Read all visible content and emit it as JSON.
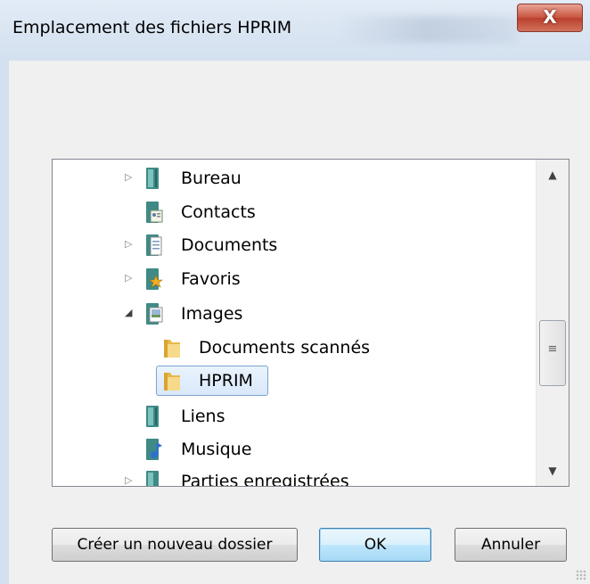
{
  "window": {
    "title": "Emplacement des fichiers HPRIM",
    "close_label": "X"
  },
  "tree": {
    "items": [
      {
        "label": "Bureau",
        "icon": "desktop-folder-icon",
        "expander": "collapsed"
      },
      {
        "label": "Contacts",
        "icon": "contacts-icon",
        "expander": "none"
      },
      {
        "label": "Documents",
        "icon": "documents-library-icon",
        "expander": "collapsed"
      },
      {
        "label": "Favoris",
        "icon": "favorites-icon",
        "expander": "collapsed"
      },
      {
        "label": "Images",
        "icon": "pictures-library-icon",
        "expander": "expanded"
      },
      {
        "label": "Documents scannés",
        "icon": "folder-icon",
        "expander": "none"
      },
      {
        "label": "HPRIM",
        "icon": "folder-icon",
        "expander": "none",
        "selected": true
      },
      {
        "label": "Liens",
        "icon": "links-icon",
        "expander": "none"
      },
      {
        "label": "Musique",
        "icon": "music-icon",
        "expander": "none"
      },
      {
        "label": "Parties enregistrées",
        "icon": "saved-games-icon",
        "expander": "collapsed"
      }
    ],
    "scrollbar": {
      "up": "▲",
      "down": "▼",
      "grip": "≡"
    }
  },
  "buttons": {
    "new_folder": "Créer un nouveau dossier",
    "ok": "OK",
    "cancel": "Annuler"
  },
  "colors": {
    "title_bar": "#d3e0ef",
    "close_button": "#c9533e",
    "selection": "#d9e8fb",
    "default_button": "#bee6fd"
  }
}
